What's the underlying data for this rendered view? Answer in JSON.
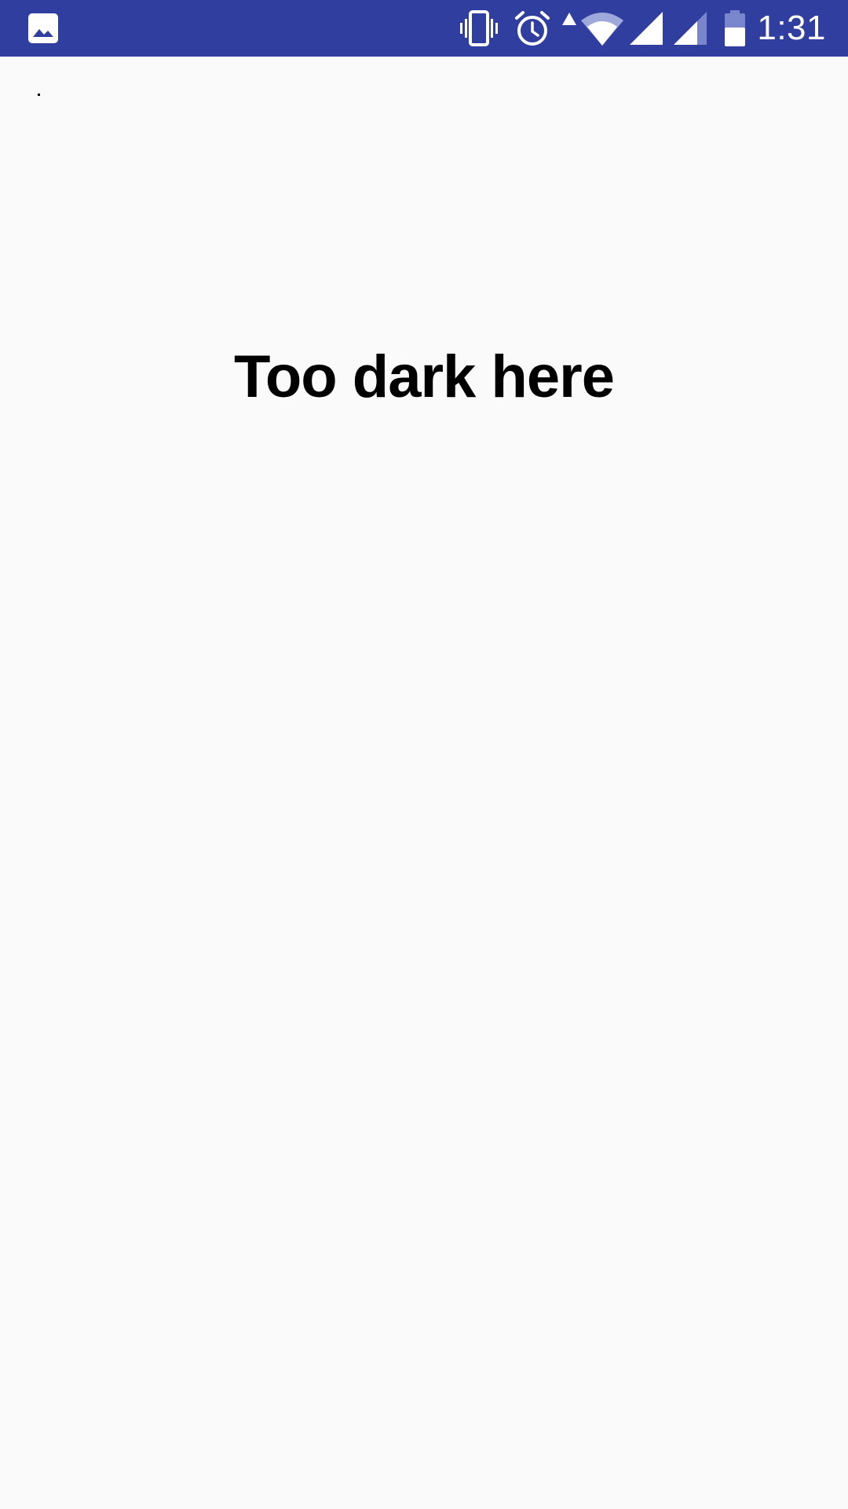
{
  "status_bar": {
    "background_color": "#303f9f",
    "notification_icon": "image-icon",
    "status_icons": [
      "vibrate-icon",
      "alarm-icon",
      "data-arrow-icon",
      "wifi-icon",
      "signal-icon",
      "signal-icon-2",
      "battery-icon"
    ],
    "time": "1:31"
  },
  "main": {
    "dot_text": ".",
    "headline": "Too dark here"
  }
}
